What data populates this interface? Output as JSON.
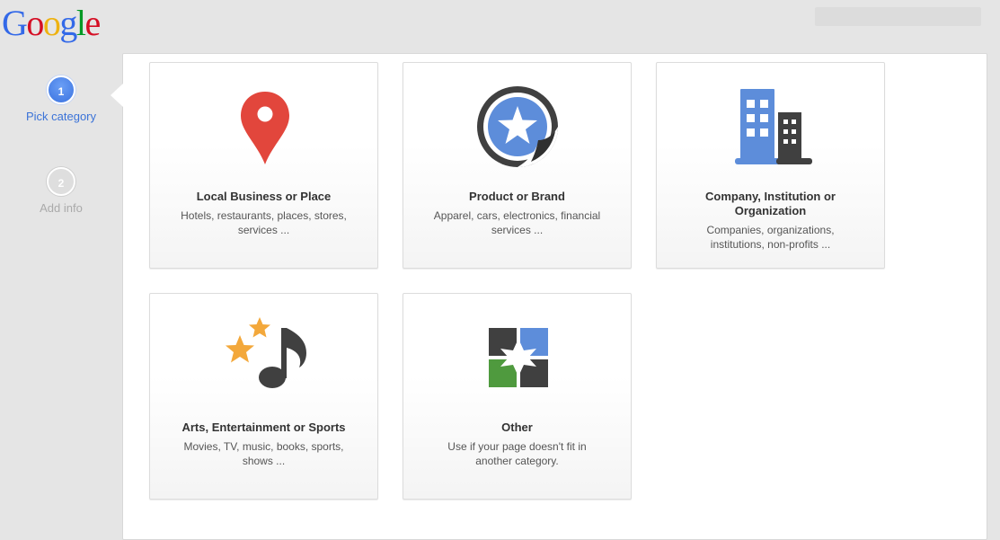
{
  "logo": {
    "text": "Google"
  },
  "steps": [
    {
      "number": "1",
      "label": "Pick category",
      "state": "active"
    },
    {
      "number": "2",
      "label": "Add info",
      "state": "inactive"
    }
  ],
  "categories": [
    {
      "title": "Local Business or Place",
      "description": "Hotels, restaurants, places, stores, services ...",
      "icon": "map-pin-icon"
    },
    {
      "title": "Product or Brand",
      "description": "Apparel, cars, electronics, financial services ...",
      "icon": "star-sticker-icon"
    },
    {
      "title": "Company, Institution or Organization",
      "description": "Companies, organizations, institutions, non-profits ...",
      "icon": "buildings-icon"
    },
    {
      "title": "Arts, Entertainment or Sports",
      "description": "Movies, TV, music, books, sports, shows ...",
      "icon": "music-stars-icon"
    },
    {
      "title": "Other",
      "description": "Use if your page doesn't fit in another category.",
      "icon": "puzzle-squares-icon"
    }
  ],
  "colors": {
    "google_blue": "#3369e8",
    "google_red": "#d50f25",
    "google_yellow": "#eeb211",
    "google_green": "#009925",
    "active_step": "#3b73e0",
    "pin_red": "#e2463c",
    "icon_dark": "#404040",
    "icon_blue": "#5d8dda",
    "star_yellow": "#f3a83b",
    "green_square": "#4f9a3e"
  }
}
